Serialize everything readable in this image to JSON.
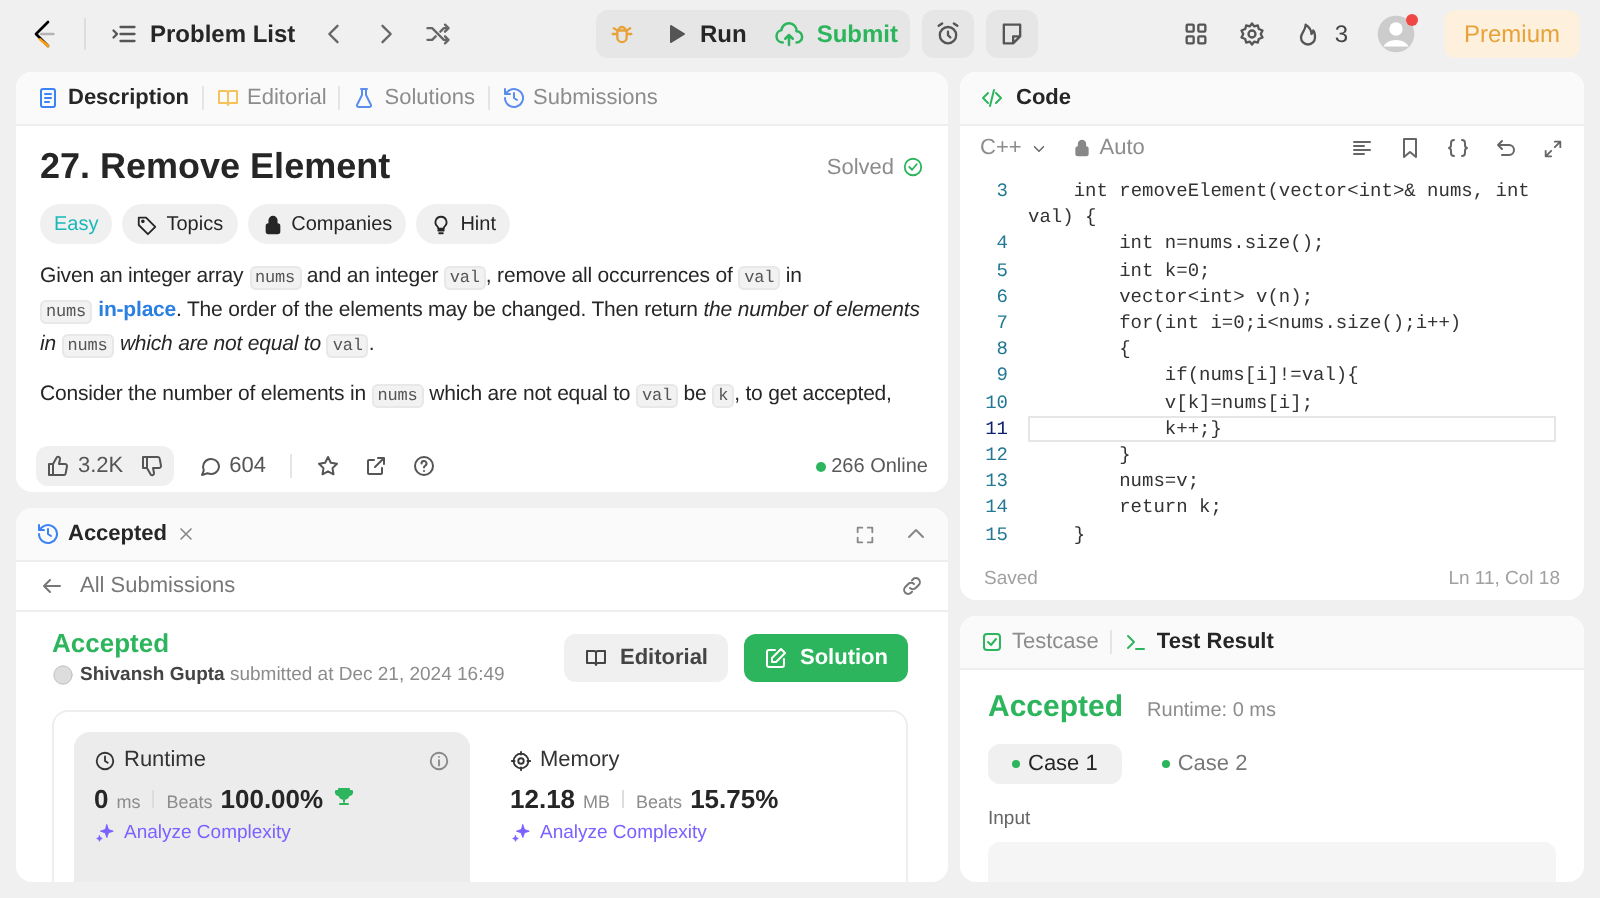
{
  "top_bar": {
    "problem_list": "Problem List",
    "run": "Run",
    "submit": "Submit",
    "streak": "3",
    "has_notification": true,
    "premium": "Premium"
  },
  "description_tabs": [
    {
      "label": "Description",
      "selected": true
    },
    {
      "label": "Editorial",
      "selected": false
    },
    {
      "label": "Solutions",
      "selected": false
    },
    {
      "label": "Submissions",
      "selected": false
    }
  ],
  "problem": {
    "title": "27. Remove Element",
    "status": "Solved",
    "difficulty": "Easy",
    "tags": [
      "Topics",
      "Companies",
      "Hint"
    ],
    "paragraphs": [
      [
        {
          "kind": "text",
          "text": "Given an integer array "
        },
        {
          "kind": "code",
          "text": "nums"
        },
        {
          "kind": "text",
          "text": " and an integer "
        },
        {
          "kind": "code",
          "text": "val"
        },
        {
          "kind": "text",
          "text": ", remove all occurrences of "
        },
        {
          "kind": "code",
          "text": "val"
        },
        {
          "kind": "text",
          "text": " in "
        },
        {
          "kind": "code",
          "text": "nums"
        },
        {
          "kind": "link",
          "text": "in-place"
        },
        {
          "kind": "text",
          "text": ". The order of the elements may be changed. Then return "
        },
        {
          "kind": "italic",
          "text": "the number of elements in "
        },
        {
          "kind": "code",
          "text": "nums"
        },
        {
          "kind": "italic",
          "text": "which are not equal to "
        },
        {
          "kind": "code",
          "text": "val"
        },
        {
          "kind": "text",
          "text": "."
        }
      ],
      [
        {
          "kind": "text",
          "text": "Consider the number of elements in "
        },
        {
          "kind": "code",
          "text": "nums"
        },
        {
          "kind": "text",
          "text": " which are not equal to "
        },
        {
          "kind": "code",
          "text": "val"
        },
        {
          "kind": "text",
          "text": " be "
        },
        {
          "kind": "code",
          "text": "k"
        },
        {
          "kind": "text",
          "text": ", to get accepted,"
        }
      ]
    ]
  },
  "description_footer": {
    "likes": "3.2K",
    "comments": "604",
    "online": "266 Online"
  },
  "submission_panel": {
    "tab": "Accepted",
    "back": "All Submissions",
    "status": "Accepted",
    "author": "Shivansh Gupta",
    "submitted": "submitted at Dec 21, 2024 16:49",
    "editorial": "Editorial",
    "solution": "Solution",
    "metrics": [
      {
        "name": "Runtime",
        "selected": true,
        "info": true,
        "value": "0",
        "unit": "ms",
        "beats_label": "Beats",
        "beats": "100.00%",
        "top_badge": true,
        "analyze": "Analyze Complexity"
      },
      {
        "name": "Memory",
        "selected": false,
        "info": false,
        "value": "12.18",
        "unit": "MB",
        "beats_label": "Beats",
        "beats": "15.75%",
        "top_badge": false,
        "analyze": "Analyze Complexity"
      }
    ]
  },
  "code_panel": {
    "title": "Code",
    "language": "C++",
    "mode": "Auto",
    "status": "Saved",
    "cursor": "Ln 11, Col 18",
    "lines": [
      {
        "number": "3",
        "text": "    int removeElement(vector<int>& nums, int val) {",
        "current": false
      },
      {
        "number": "4",
        "text": "        int n=nums.size();",
        "current": false
      },
      {
        "number": "5",
        "text": "        int k=0;",
        "current": false
      },
      {
        "number": "6",
        "text": "        vector<int> v(n);",
        "current": false
      },
      {
        "number": "7",
        "text": "        for(int i=0;i<nums.size();i++)",
        "current": false
      },
      {
        "number": "8",
        "text": "        {",
        "current": false
      },
      {
        "number": "9",
        "text": "            if(nums[i]!=val){",
        "current": false
      },
      {
        "number": "10",
        "text": "            v[k]=nums[i];",
        "current": false
      },
      {
        "number": "11",
        "text": "            k++;}",
        "current": true
      },
      {
        "number": "12",
        "text": "        }",
        "current": false
      },
      {
        "number": "13",
        "text": "        nums=v;",
        "current": false
      },
      {
        "number": "14",
        "text": "        return k;",
        "current": false
      },
      {
        "number": "15",
        "text": "    }",
        "current": false
      }
    ]
  },
  "result_panel": {
    "tabs": [
      {
        "label": "Testcase",
        "selected": false
      },
      {
        "label": "Test Result",
        "selected": true
      }
    ],
    "verdict": "Accepted",
    "runtime": "Runtime: 0 ms",
    "cases": [
      {
        "label": "Case 1",
        "selected": true,
        "passed": true
      },
      {
        "label": "Case 2",
        "selected": false,
        "passed": true
      }
    ],
    "input_label": "Input"
  }
}
